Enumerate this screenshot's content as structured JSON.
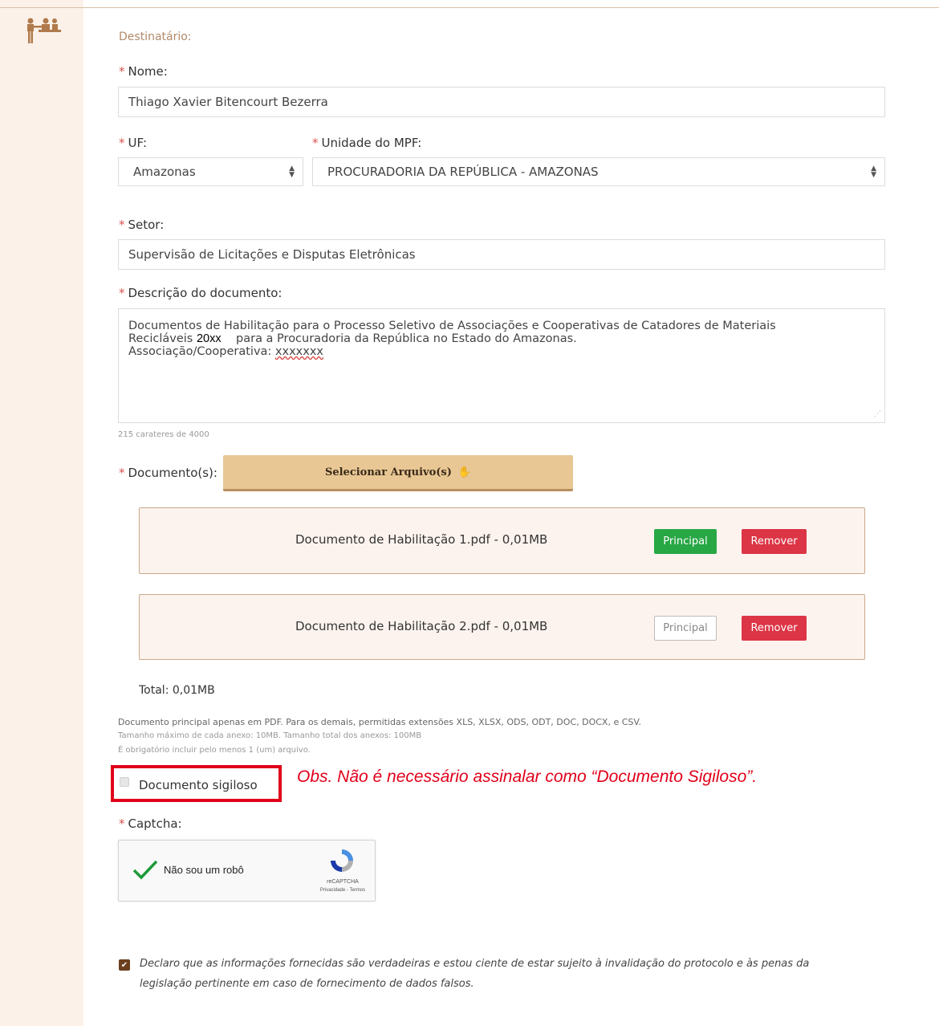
{
  "section": {
    "title": "Destinatário:"
  },
  "form": {
    "required_mark": "*",
    "nome": {
      "label": "Nome:",
      "value": "Thiago Xavier Bitencourt Bezerra"
    },
    "uf": {
      "label": "UF:",
      "value": "Amazonas"
    },
    "unidade": {
      "label": "Unidade do MPF:",
      "value": "PROCURADORIA DA REPÚBLICA - AMAZONAS"
    },
    "setor": {
      "label": "Setor:",
      "value": "Supervisão de Licitações e Disputas Eletrônicas"
    },
    "descricao": {
      "label": "Descrição do documento:",
      "line1": "Documentos de Habilitação para o Processo Seletivo de Associações e Cooperativas de Catadores de Materiais",
      "line2_a": "Recicláveis",
      "line2_year": "20xx",
      "line2_b": "para a Procuradoria da República no Estado do Amazonas.",
      "line3_label": "Associação/Cooperativa:",
      "line3_value": "xxxxxxx",
      "char_count": "215 carateres de 4000"
    },
    "documentos": {
      "label": "Documento(s):",
      "select_button": "Selecionar Arquivo(s)",
      "files": [
        {
          "name": "Documento de Habilitação 1.pdf - 0,01MB",
          "principal_label": "Principal",
          "remove_label": "Remover"
        },
        {
          "name": "Documento de Habilitação 2.pdf - 0,01MB",
          "principal_label": "Principal",
          "remove_label": "Remover"
        }
      ],
      "total": "Total: 0,01MB",
      "help_main": "Documento principal apenas em PDF. Para os demais, permitidas extensões XLS, XLSX, ODS, ODT, DOC, DOCX, e CSV.",
      "help_size": "Tamanho máximo de cada anexo: 10MB. Tamanho total dos anexos: 100MB",
      "help_required": "É obrigatório incluir pelo menos 1 (um) arquivo."
    },
    "sigiloso": {
      "label": "Documento sigiloso",
      "checked": false
    },
    "obs": "Obs. Não é necessário assinalar como “Documento Sigiloso”.",
    "captcha": {
      "label": "Captcha:",
      "text": "Não sou um robô",
      "brand": "reCAPTCHA",
      "links": "Privacidade - Termos"
    },
    "declaracao": {
      "line1": "Declaro que as informações fornecidas são verdadeiras e estou ciente de estar sujeito à invalidação do protocolo e às penas da",
      "line2": "legislação pertinente em caso de fornecimento de dados falsos.",
      "checked": true
    }
  },
  "colors": {
    "sidebar": "#fcf1e8",
    "accent_brown": "#8a5a34",
    "principal_green": "#28a745",
    "remove_red": "#dc3545",
    "highlight_red": "#e1001a"
  }
}
